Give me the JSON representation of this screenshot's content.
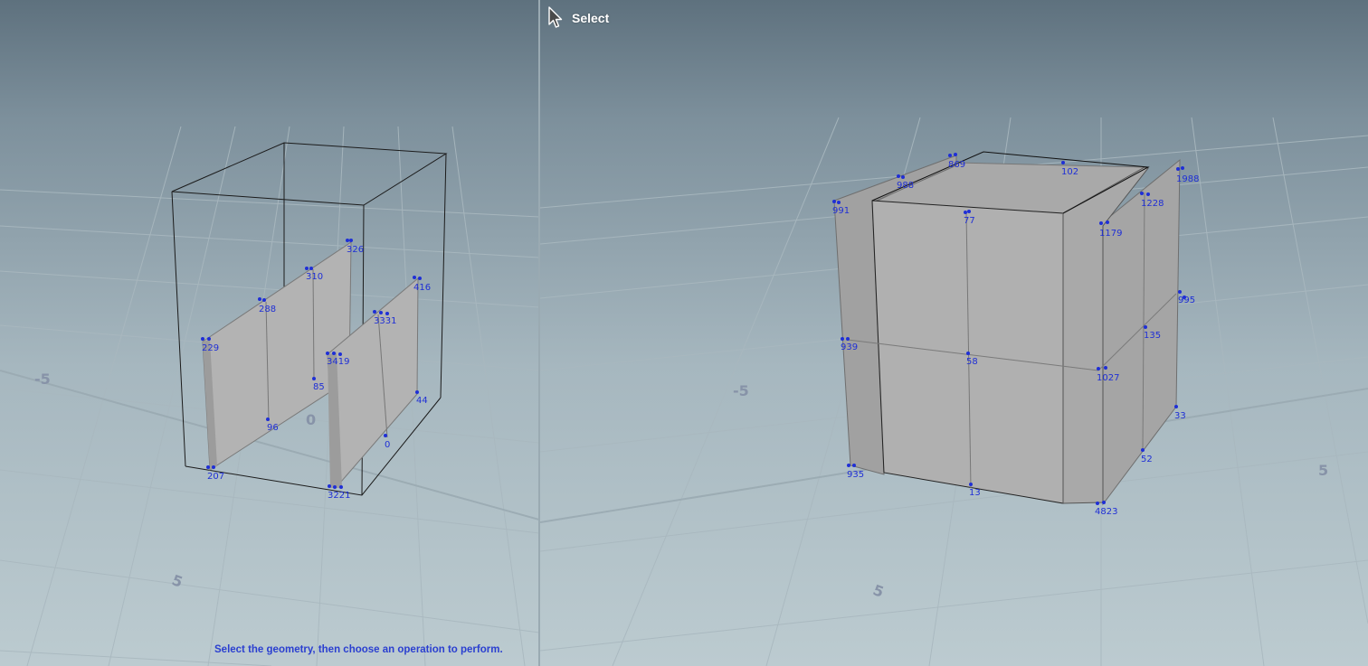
{
  "toolbar": {
    "tool_name": "Select",
    "tool_icon": "arrow-cursor-icon"
  },
  "status": {
    "hint": "Select the geometry, then choose an operation to perform."
  },
  "grid_labels": {
    "left": [
      "-5",
      "0",
      "5"
    ],
    "right": [
      "-5",
      "5",
      "5"
    ]
  },
  "left_viewport": {
    "points": [
      {
        "id": "326"
      },
      {
        "id": "310"
      },
      {
        "id": "288"
      },
      {
        "id": "229"
      },
      {
        "id": "85"
      },
      {
        "id": "96"
      },
      {
        "id": "207"
      },
      {
        "id": "3419"
      },
      {
        "id": "3331"
      },
      {
        "id": "416"
      },
      {
        "id": "44"
      },
      {
        "id": "0"
      },
      {
        "id": "3221"
      }
    ]
  },
  "right_viewport": {
    "points": [
      {
        "id": "869"
      },
      {
        "id": "102"
      },
      {
        "id": "1988"
      },
      {
        "id": "988"
      },
      {
        "id": "991"
      },
      {
        "id": "77"
      },
      {
        "id": "1179"
      },
      {
        "id": "1228"
      },
      {
        "id": "939"
      },
      {
        "id": "58"
      },
      {
        "id": "995"
      },
      {
        "id": "135"
      },
      {
        "id": "1027"
      },
      {
        "id": "33"
      },
      {
        "id": "935"
      },
      {
        "id": "13"
      },
      {
        "id": "52"
      },
      {
        "id": "4823"
      }
    ]
  },
  "colors": {
    "point": "#1f2fd6",
    "face": "#b0b0b0",
    "hint": "#2a3fd0"
  }
}
